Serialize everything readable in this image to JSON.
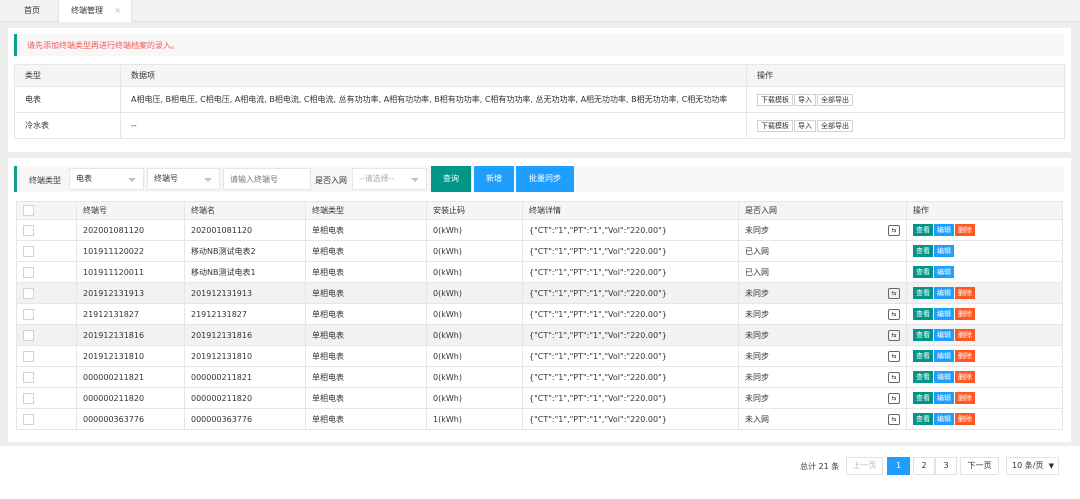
{
  "tabs": {
    "home": "首页",
    "active": "终端管理",
    "close": "×"
  },
  "notice": "请先添加终端类型再进行终端档案的录入。",
  "type_table": {
    "headers": [
      "类型",
      "数据项",
      "操作"
    ],
    "rows": [
      {
        "type": "电表",
        "items": "A相电压, B相电压, C相电压, A相电流, B相电流, C相电流, 总有功功率, A相有功功率, B相有功功率, C相有功功率, 总无功功率, A相无功功率, B相无功功率, C相无功功率",
        "actions": [
          "下载模板",
          "导入",
          "全部导出"
        ]
      },
      {
        "type": "冷水表",
        "items": "--",
        "actions": [
          "下载模板",
          "导入",
          "全部导出"
        ]
      }
    ]
  },
  "filters": {
    "type_label": "终端类型",
    "type_value": "电表",
    "field_value": "终端号",
    "search_placeholder": "请输入终端号",
    "net_label": "是否入网",
    "net_placeholder": "--请选择--",
    "query": "查询",
    "add": "新增",
    "batch_sync": "批量同步"
  },
  "terminal_table": {
    "headers": [
      "终端号",
      "终端名",
      "终端类型",
      "安装止码",
      "终端详情",
      "是否入网",
      "操作"
    ],
    "actions": {
      "view": "查看",
      "edit": "编辑",
      "delete": "删除"
    },
    "sync_icon_label": "⇆",
    "rows": [
      {
        "no": "202001081120",
        "name": "202001081120",
        "type": "单相电表",
        "code": "0(kWh)",
        "detail": "{\"CT\":\"1\",\"PT\":\"1\",\"Vol\":\"220.00\"}",
        "net": "未同步",
        "sync": true,
        "del": true
      },
      {
        "no": "101911120022",
        "name": "移动NB测试电表2",
        "type": "单相电表",
        "code": "0(kWh)",
        "detail": "{\"CT\":\"1\",\"PT\":\"1\",\"Vol\":\"220.00\"}",
        "net": "已入网",
        "sync": false,
        "del": false
      },
      {
        "no": "101911120011",
        "name": "移动NB测试电表1",
        "type": "单相电表",
        "code": "0(kWh)",
        "detail": "{\"CT\":\"1\",\"PT\":\"1\",\"Vol\":\"220.00\"}",
        "net": "已入网",
        "sync": false,
        "del": false
      },
      {
        "no": "201912131913",
        "name": "201912131913",
        "type": "单相电表",
        "code": "0(kWh)",
        "detail": "{\"CT\":\"1\",\"PT\":\"1\",\"Vol\":\"220.00\"}",
        "net": "未同步",
        "sync": true,
        "del": true
      },
      {
        "no": "21912131827",
        "name": "21912131827",
        "type": "单相电表",
        "code": "0(kWh)",
        "detail": "{\"CT\":\"1\",\"PT\":\"1\",\"Vol\":\"220.00\"}",
        "net": "未同步",
        "sync": true,
        "del": true
      },
      {
        "no": "201912131816",
        "name": "201912131816",
        "type": "单相电表",
        "code": "0(kWh)",
        "detail": "{\"CT\":\"1\",\"PT\":\"1\",\"Vol\":\"220.00\"}",
        "net": "未同步",
        "sync": true,
        "del": true
      },
      {
        "no": "201912131810",
        "name": "201912131810",
        "type": "单相电表",
        "code": "0(kWh)",
        "detail": "{\"CT\":\"1\",\"PT\":\"1\",\"Vol\":\"220.00\"}",
        "net": "未同步",
        "sync": true,
        "del": true
      },
      {
        "no": "000000211821",
        "name": "000000211821",
        "type": "单相电表",
        "code": "0(kWh)",
        "detail": "{\"CT\":\"1\",\"PT\":\"1\",\"Vol\":\"220.00\"}",
        "net": "未同步",
        "sync": true,
        "del": true
      },
      {
        "no": "000000211820",
        "name": "000000211820",
        "type": "单相电表",
        "code": "0(kWh)",
        "detail": "{\"CT\":\"1\",\"PT\":\"1\",\"Vol\":\"220.00\"}",
        "net": "未同步",
        "sync": true,
        "del": true
      },
      {
        "no": "000000363776",
        "name": "000000363776",
        "type": "单相电表",
        "code": "1(kWh)",
        "detail": "{\"CT\":\"1\",\"PT\":\"1\",\"Vol\":\"220.00\"}",
        "net": "未入网",
        "sync": true,
        "del": true
      }
    ]
  },
  "pagination": {
    "total": "总计 21 条",
    "prev": "上一页",
    "pages": [
      "1",
      "2",
      "3"
    ],
    "current": "1",
    "next": "下一页",
    "page_size": "10 条/页"
  }
}
